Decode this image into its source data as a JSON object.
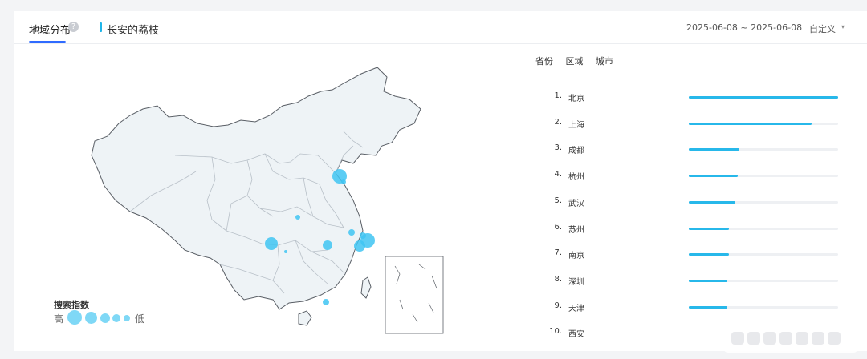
{
  "header": {
    "tab_title": "地域分布",
    "help_icon": "?",
    "keyword": "长安的荔枝",
    "date_range": "2025-06-08 ~ 2025-06-08",
    "custom_label": "自定义",
    "caret": "▾"
  },
  "legend": {
    "title": "搜索指数",
    "high": "高",
    "low": "低"
  },
  "subtabs": [
    "省份",
    "区域",
    "城市"
  ],
  "ranking": [
    {
      "rank": "1.",
      "city": "北京",
      "value": 1.0
    },
    {
      "rank": "2.",
      "city": "上海",
      "value": 0.82
    },
    {
      "rank": "3.",
      "city": "成都",
      "value": 0.34
    },
    {
      "rank": "4.",
      "city": "杭州",
      "value": 0.33
    },
    {
      "rank": "5.",
      "city": "武汉",
      "value": 0.31
    },
    {
      "rank": "6.",
      "city": "苏州",
      "value": 0.27
    },
    {
      "rank": "7.",
      "city": "南京",
      "value": 0.27
    },
    {
      "rank": "8.",
      "city": "深圳",
      "value": 0.26
    },
    {
      "rank": "9.",
      "city": "天津",
      "value": 0.26
    },
    {
      "rank": "10.",
      "city": "西安",
      "value": 0
    }
  ],
  "colors": {
    "accent": "#2f6bff",
    "bar": "#27b8ea",
    "bubble": "#40c4f2",
    "map_fill": "#eef3f6"
  }
}
